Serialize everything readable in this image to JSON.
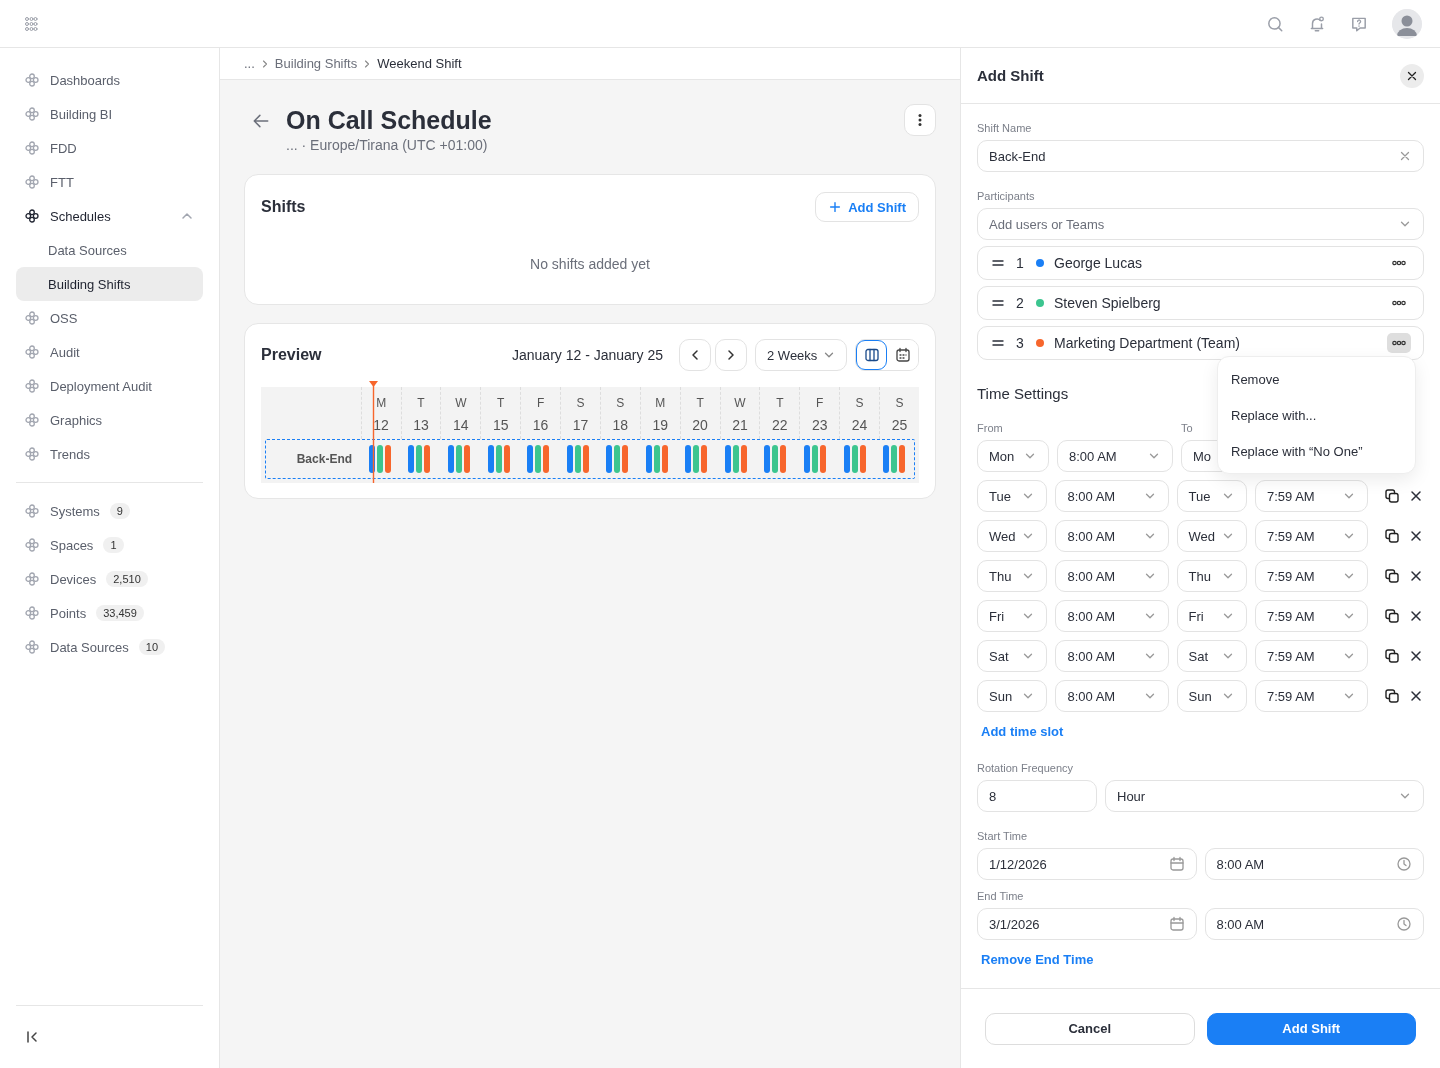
{
  "sidebar": {
    "groups": [
      {
        "items": [
          {
            "label": "Dashboards",
            "selected": false
          },
          {
            "label": "Building BI",
            "selected": false
          },
          {
            "label": "FDD",
            "selected": false
          },
          {
            "label": "FTT",
            "selected": false
          },
          {
            "label": "Schedules",
            "selected": false,
            "expanded": true,
            "children": [
              {
                "label": "Data Sources",
                "selected": false
              },
              {
                "label": "Building Shifts",
                "selected": true
              }
            ]
          },
          {
            "label": "OSS",
            "selected": false
          },
          {
            "label": "Audit",
            "selected": false
          },
          {
            "label": "Deployment Audit",
            "selected": false
          },
          {
            "label": "Graphics",
            "selected": false
          },
          {
            "label": "Trends",
            "selected": false
          }
        ]
      },
      {
        "items": [
          {
            "label": "Systems",
            "badge": "9",
            "selected": false
          },
          {
            "label": "Spaces",
            "badge": "1",
            "selected": false
          },
          {
            "label": "Devices",
            "badge": "2,510",
            "selected": false
          },
          {
            "label": "Points",
            "badge": "33,459",
            "selected": false
          },
          {
            "label": "Data Sources",
            "badge": "10",
            "selected": false
          }
        ]
      }
    ]
  },
  "breadcrumb": [
    "...",
    "Building Shifts",
    "Weekend Shift"
  ],
  "page": {
    "title": "On Call Schedule",
    "subtitle": "... · Europe/Tirana (UTC +01:00)"
  },
  "shifts_card": {
    "title": "Shifts",
    "add_button": "Add Shift",
    "empty_text": "No shifts added yet"
  },
  "preview": {
    "title": "Preview",
    "range": "January 12 - January 25",
    "period": "2 Weeks",
    "views": [
      {
        "kind": "columns",
        "selected": true
      },
      {
        "kind": "calendar",
        "selected": false
      }
    ],
    "days": [
      {
        "letter": "M",
        "date": "12",
        "today": true
      },
      {
        "letter": "T",
        "date": "13",
        "today": false
      },
      {
        "letter": "W",
        "date": "14",
        "today": false
      },
      {
        "letter": "T",
        "date": "15",
        "today": false
      },
      {
        "letter": "F",
        "date": "16",
        "today": false
      },
      {
        "letter": "S",
        "date": "17",
        "today": false
      },
      {
        "letter": "S",
        "date": "18",
        "today": false
      },
      {
        "letter": "M",
        "date": "19",
        "today": false
      },
      {
        "letter": "T",
        "date": "20",
        "today": false
      },
      {
        "letter": "W",
        "date": "21",
        "today": false
      },
      {
        "letter": "T",
        "date": "22",
        "today": false
      },
      {
        "letter": "F",
        "date": "23",
        "today": false
      },
      {
        "letter": "S",
        "date": "24",
        "today": false
      },
      {
        "letter": "S",
        "date": "25",
        "today": false
      }
    ],
    "rows": [
      {
        "label": "Back-End"
      }
    ]
  },
  "panel": {
    "title": "Add Shift",
    "shift_name": {
      "label": "Shift Name",
      "value": "Back-End"
    },
    "participants": {
      "label": "Participants",
      "placeholder": "Add users or Teams",
      "items": [
        {
          "index": "1",
          "name": "George Lucas",
          "color": "#1a7ff5",
          "menu_open": false
        },
        {
          "index": "2",
          "name": "Steven Spielberg",
          "color": "#3cc58f",
          "menu_open": false
        },
        {
          "index": "3",
          "name": "Marketing Department (Team)",
          "color": "#f7662c",
          "menu_open": true
        }
      ]
    },
    "context_menu": [
      "Remove",
      "Replace with...",
      "Replace with “No One”"
    ],
    "time_settings": {
      "title": "Time Settings",
      "from_label": "From",
      "to_label": "To",
      "slots": [
        {
          "from_day": "Mon",
          "from_time": "8:00 AM",
          "to_day": "Mo"
        },
        {
          "from_day": "Tue",
          "from_time": "8:00 AM",
          "to_day": "Tue",
          "to_time": "7:59 AM"
        },
        {
          "from_day": "Wed",
          "from_time": "8:00 AM",
          "to_day": "Wed",
          "to_time": "7:59 AM"
        },
        {
          "from_day": "Thu",
          "from_time": "8:00 AM",
          "to_day": "Thu",
          "to_time": "7:59 AM"
        },
        {
          "from_day": "Fri",
          "from_time": "8:00 AM",
          "to_day": "Fri",
          "to_time": "7:59 AM"
        },
        {
          "from_day": "Sat",
          "from_time": "8:00 AM",
          "to_day": "Sat",
          "to_time": "7:59 AM"
        },
        {
          "from_day": "Sun",
          "from_time": "8:00 AM",
          "to_day": "Sun",
          "to_time": "7:59 AM"
        }
      ],
      "add_link": "Add time slot"
    },
    "rotation": {
      "label": "Rotation Frequency",
      "value": "8",
      "unit": "Hour"
    },
    "start": {
      "label": "Start Time",
      "date": "1/12/2026",
      "time": "8:00 AM"
    },
    "end": {
      "label": "End Time",
      "date": "3/1/2026",
      "time": "8:00 AM"
    },
    "remove_end_link": "Remove End Time",
    "buttons": {
      "cancel": "Cancel",
      "submit": "Add Shift"
    }
  }
}
